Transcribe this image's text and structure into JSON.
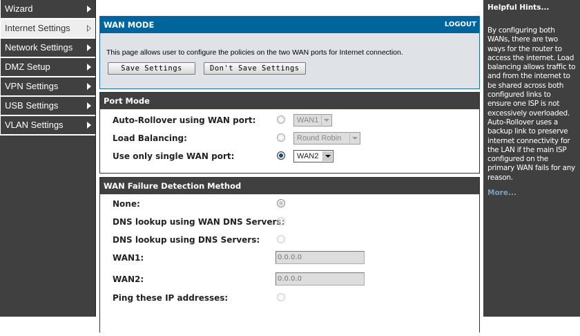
{
  "sidebar": {
    "items": [
      {
        "label": "Wizard"
      },
      {
        "label": "Internet Settings"
      },
      {
        "label": "Network Settings"
      },
      {
        "label": "DMZ Setup"
      },
      {
        "label": "VPN Settings"
      },
      {
        "label": "USB Settings"
      },
      {
        "label": "VLAN Settings"
      }
    ]
  },
  "wan_mode": {
    "title": "WAN MODE",
    "logout": "LOGOUT",
    "description": "This page allows user to configure the policies on the two WAN ports for Internet connection.",
    "save": "Save Settings",
    "dont_save": "Don't Save Settings"
  },
  "port_mode": {
    "title": "Port Mode",
    "rows": [
      {
        "label": "Auto-Rollover using WAN port:",
        "select": "WAN1",
        "selected": false
      },
      {
        "label": "Load Balancing:",
        "select": "Round Robin",
        "selected": false
      },
      {
        "label": "Use only single WAN port:",
        "select": "WAN2",
        "selected": true
      }
    ]
  },
  "failure": {
    "title": "WAN Failure Detection Method",
    "none": "None:",
    "dns_wan": "DNS lookup using WAN DNS Servers:",
    "dns": "DNS lookup using DNS Servers:",
    "wan1_label": "WAN1:",
    "wan1_value": "0.0.0.0",
    "wan2_label": "WAN2:",
    "wan2_value": "0.0.0.0",
    "ping": "Ping these IP addresses:"
  },
  "hints": {
    "title": "Helpful Hints...",
    "text": "By configuring both WANs, there are two ways for the router to access the internet. Load balancing allows traffic to and from the internet to be shared across both configured links to ensure one ISP is not excessively overloaded. Auto-Rollover uses a backup link to preserve internet connectivity for the LAN if the main ISP configured on the primary WAN fails for any reason.",
    "more": "More..."
  },
  "colors": {
    "header_blue": "#00659c",
    "dark": "#404040"
  }
}
